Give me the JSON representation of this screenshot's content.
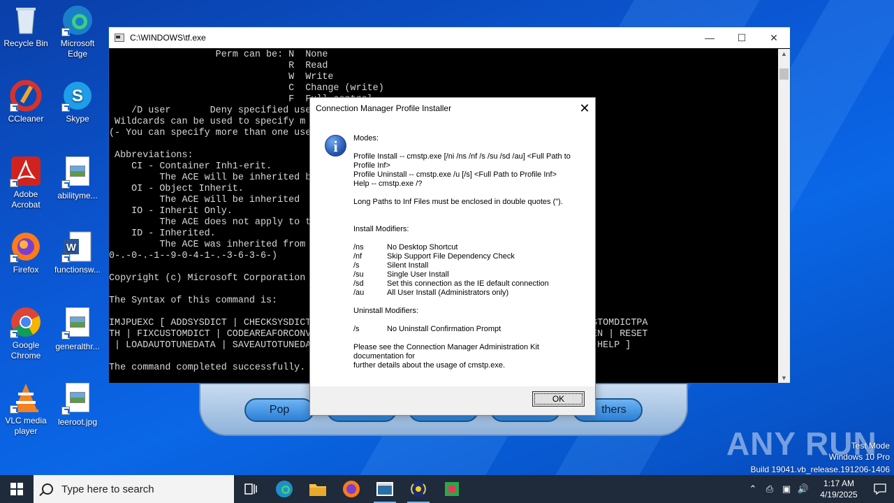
{
  "desktop": {
    "icons": [
      {
        "label": "Recycle Bin",
        "icon": "recycle-bin-icon"
      },
      {
        "label": "Microsoft Edge",
        "icon": "edge-icon"
      },
      {
        "label": "CCleaner",
        "icon": "ccleaner-icon"
      },
      {
        "label": "Skype",
        "icon": "skype-icon"
      },
      {
        "label": "Adobe Acrobat",
        "icon": "acrobat-icon"
      },
      {
        "label": "abilityme...",
        "icon": "image-file-icon"
      },
      {
        "label": "Firefox",
        "icon": "firefox-icon"
      },
      {
        "label": "functionsw...",
        "icon": "word-doc-icon"
      },
      {
        "label": "Google Chrome",
        "icon": "chrome-icon"
      },
      {
        "label": "generalthr...",
        "icon": "image-file-icon"
      },
      {
        "label": "VLC media player",
        "icon": "vlc-icon"
      },
      {
        "label": "leeroot.jpg",
        "icon": "image-file-icon"
      }
    ]
  },
  "background_app": {
    "buttons": [
      "Pop",
      "",
      "",
      "",
      "thers"
    ]
  },
  "console": {
    "title": "C:\\WINDOWS\\tf.exe",
    "lines": [
      "                   Perm can be: N  None",
      "                                R  Read",
      "                                W  Write",
      "                                C  Change (write)",
      "                                F  Full control",
      "    /D user       Deny specified use",
      " Wildcards can be used to specify m",
      "(- You can specify more than one use",
      "",
      " Abbreviations:",
      "    CI - Container Inh1-erit.",
      "         The ACE will be inherited b",
      "    OI - Object Inherit.",
      "         The ACE will be inherited",
      "    IO - Inherit Only.",
      "         The ACE does not apply to t",
      "    ID - Inherited.",
      "         The ACE was inherited from",
      "0-.-0-.-1--9-0-4-1-.-3-6-3-6-)",
      "",
      "Copyright (c) Microsoft Corporation",
      "",
      "The Syntax of this command is:",
      "",
      "IMJPUEXC [ ADDSYSDICT | CHECKSYSDICT                           TCUSTOMDICTPATH | GETCUSTOMDICTPA",
      "TH | FIXCUSTOMDICT | CODEAREAFORCONV                           KEYTEMPLATE | SETKUTOUTEN | RESET",
      " | LOADAUTOTUNEDATA | SAVEAUTOTUNEDA                         DICT | REMOVEFILTERDICT | HELP ]",
      "",
      "The command completed successfully."
    ]
  },
  "dialog": {
    "title": "Connection Manager Profile Installer",
    "modes_heading": "Modes:",
    "profile_install": "Profile Install -- cmstp.exe [/ni /ns /nf /s /su /sd /au] <Full Path to Profile Inf>",
    "profile_uninstall": "Profile Uninstall -- cmstp.exe /u [/s] <Full Path to Profile Inf>",
    "help": "Help -- cmstp.exe /?",
    "long_paths": "Long Paths to Inf Files must be enclosed in double quotes (\").",
    "install_modifiers_heading": "Install Modifiers:",
    "install_modifiers": [
      {
        "flag": "/ns",
        "desc": "No Desktop Shortcut"
      },
      {
        "flag": "/nf",
        "desc": "Skip Support File Dependency Check"
      },
      {
        "flag": "/s",
        "desc": "Silent Install"
      },
      {
        "flag": "/su",
        "desc": "Single User Install"
      },
      {
        "flag": "/sd",
        "desc": "Set this connection as the IE default connection"
      },
      {
        "flag": "/au",
        "desc": "All User Install (Administrators only)"
      }
    ],
    "uninstall_modifiers_heading": "Uninstall Modifiers:",
    "uninstall_modifiers": [
      {
        "flag": "/s",
        "desc": "No Uninstall Confirmation Prompt"
      }
    ],
    "footer_line1": "Please see the Connection Manager Administration Kit documentation for",
    "footer_line2": "further details about the usage of cmstp.exe.",
    "ok_label": "OK"
  },
  "watermark": {
    "logo": "ANY RUN",
    "mode": "Test Mode",
    "edition": "Windows 10 Pro",
    "build": "Build 19041.vb_release.191206-1406"
  },
  "taskbar": {
    "search_placeholder": "Type here to search",
    "time": "1:17 AM",
    "date": "4/19/2025"
  }
}
